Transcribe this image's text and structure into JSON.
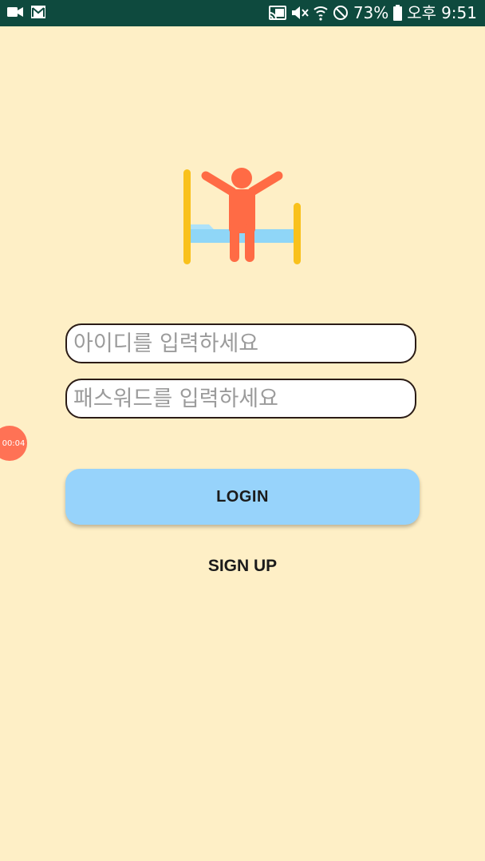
{
  "status_bar": {
    "battery_percent": "73%",
    "ampm": "오후",
    "time": "9:51",
    "left_icons": [
      "video-camera-icon",
      "gmail-icon"
    ],
    "right_icons": [
      "cast-icon",
      "mute-icon",
      "wifi-icon",
      "do-not-disturb-icon",
      "battery-icon"
    ],
    "background_color": "#0E4A3E"
  },
  "logo": {
    "icon": "person-standing-by-bed-icon",
    "colors": {
      "person": "#FF6B45",
      "bed_posts": "#F9C11C",
      "mattress": "#8FD6F7"
    }
  },
  "login_form": {
    "id_placeholder": "아이디를 입력하세요",
    "password_placeholder": "패스워드를 입력하세요",
    "login_label": "LOGIN",
    "signup_label": "SIGN UP"
  },
  "overlay": {
    "record_timer": "00:04"
  },
  "colors": {
    "background": "#FEEFC6",
    "login_button": "#97D3FB",
    "record_bubble": "#FF7255"
  }
}
